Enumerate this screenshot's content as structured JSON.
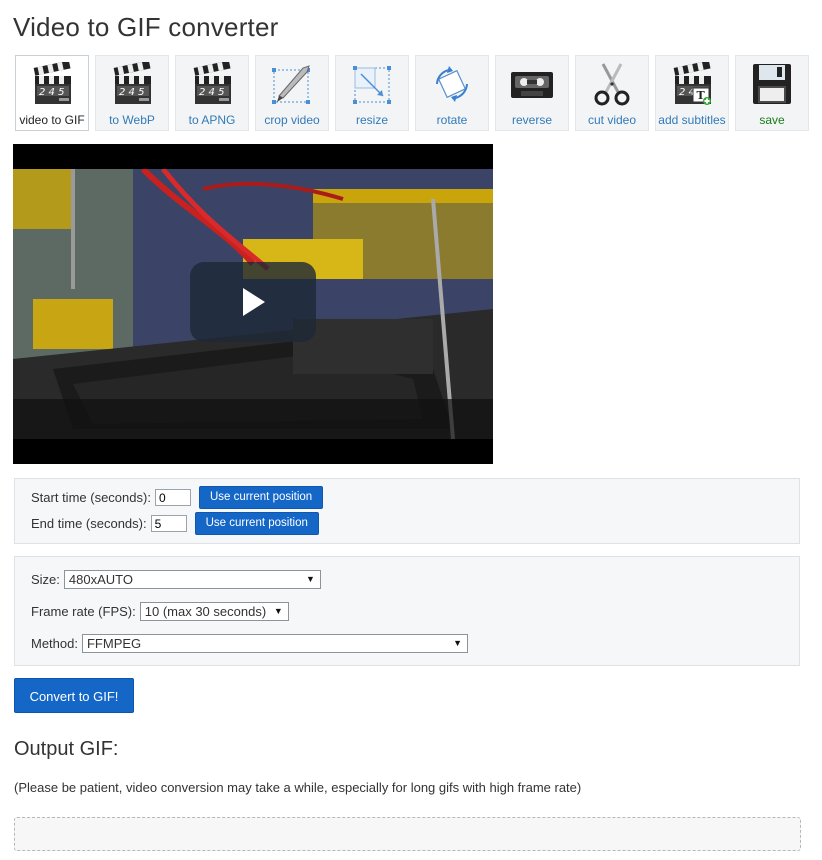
{
  "page": {
    "title": "Video to GIF converter"
  },
  "toolbar": {
    "items": [
      {
        "label": "video to GIF",
        "icon": "clapperboard-icon",
        "active": true
      },
      {
        "label": "to WebP",
        "icon": "clapperboard-icon"
      },
      {
        "label": "to APNG",
        "icon": "clapperboard-icon"
      },
      {
        "label": "crop video",
        "icon": "crop-knife-icon"
      },
      {
        "label": "resize",
        "icon": "resize-icon"
      },
      {
        "label": "rotate",
        "icon": "rotate-icon"
      },
      {
        "label": "reverse",
        "icon": "cassette-icon"
      },
      {
        "label": "cut video",
        "icon": "scissors-icon"
      },
      {
        "label": "add subtitles",
        "icon": "clapperboard-text-icon"
      },
      {
        "label": "save",
        "icon": "floppy-disk-icon"
      }
    ],
    "clapper_numbers": "2 4 5"
  },
  "timing": {
    "start_label": "Start time (seconds):",
    "start_value": "0",
    "end_label": "End time (seconds):",
    "end_value": "5",
    "use_current_label": "Use current position"
  },
  "options": {
    "size_label": "Size:",
    "size_value": "480xAUTO",
    "fps_label": "Frame rate (FPS):",
    "fps_value": "10 (max 30 seconds)",
    "method_label": "Method:",
    "method_value": "FFMPEG"
  },
  "actions": {
    "convert_label": "Convert to GIF!"
  },
  "output": {
    "title": "Output GIF:",
    "note": "(Please be patient, video conversion may take a while, especially for long gifs with high frame rate)"
  },
  "colors": {
    "primary": "#1467c7",
    "link": "#337ab7",
    "save": "#1a7a1a"
  }
}
